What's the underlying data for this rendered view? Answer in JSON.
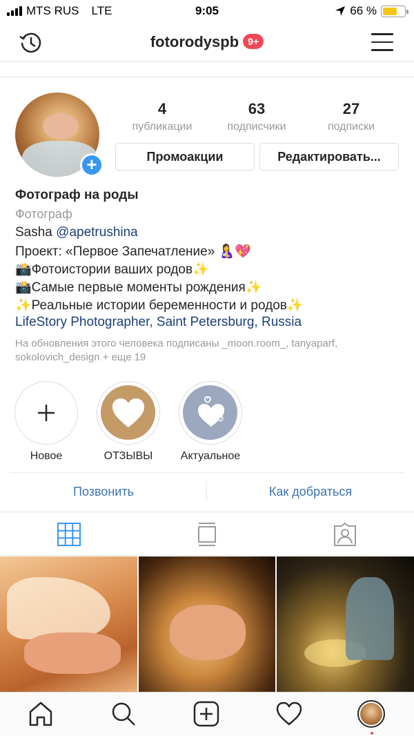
{
  "status_bar": {
    "carrier": "MTS RUS",
    "network": "LTE",
    "time": "9:05",
    "battery_text": "66 %",
    "battery_level": 0.66,
    "battery_color": "#f5c518"
  },
  "header": {
    "username": "fotorodyspb",
    "notification_badge": "9+",
    "history_icon": "history-clock-icon",
    "menu_icon": "hamburger-menu-icon"
  },
  "profile": {
    "stats": [
      {
        "value": "4",
        "label": "публикации"
      },
      {
        "value": "63",
        "label": "подписчики"
      },
      {
        "value": "27",
        "label": "подписки"
      }
    ],
    "buttons": {
      "promo": "Промоакции",
      "edit": "Редактировать..."
    },
    "add_story_icon": "plus-icon"
  },
  "bio": {
    "name": "Фотограф на роды",
    "category": "Фотограф",
    "line1_text": "Sasha ",
    "line1_mention": "@apetrushina",
    "line2": "Проект: «Первое Запечатление» 🤱💖",
    "line3": "📸Фотоистории ваших родов✨",
    "line4": "📸Самые первые моменты рождения✨",
    "line5": "✨Реальные истории беременности и родов✨",
    "location": "LifeStory Photographer, Saint Petersburg, Russia",
    "followed_by": "На обновления этого человека подписаны _moon.room_, tanyaparf, sokolovich_design + еще 19"
  },
  "highlights": [
    {
      "label": "Новое",
      "color": "#ffffff",
      "icon": "plus-icon"
    },
    {
      "label": "ОТЗЫВЫ",
      "color": "#c49a66",
      "icon": "heart-icon"
    },
    {
      "label": "Актуальное",
      "color": "#9ca8be",
      "icon": "hearts-icon"
    }
  ],
  "actions": {
    "call": "Позвонить",
    "directions": "Как добраться",
    "link_color": "#3d74b0"
  },
  "tabs": [
    {
      "name": "grid-icon",
      "active": true,
      "color": "#3897f0"
    },
    {
      "name": "feed-list-icon",
      "active": false
    },
    {
      "name": "tagged-person-icon",
      "active": false
    }
  ],
  "bottom_nav": [
    {
      "name": "home-icon"
    },
    {
      "name": "search-icon"
    },
    {
      "name": "new-post-icon"
    },
    {
      "name": "activity-heart-icon"
    },
    {
      "name": "profile-avatar"
    }
  ]
}
